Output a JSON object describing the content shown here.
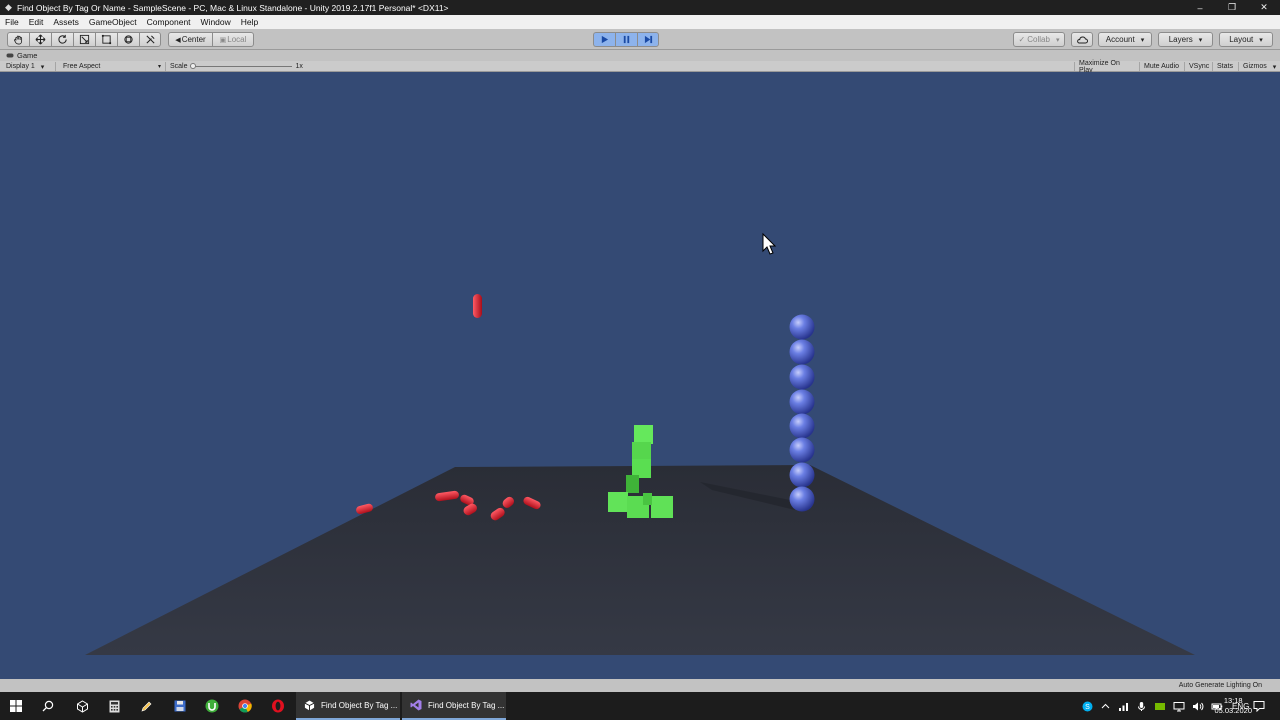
{
  "window": {
    "title": "Find Object By Tag Or Name - SampleScene - PC, Mac & Linux Standalone - Unity 2019.2.17f1 Personal* <DX11>",
    "minimize_glyph": "–",
    "maximize_glyph": "❐",
    "close_glyph": "✕"
  },
  "menu": {
    "items": [
      "File",
      "Edit",
      "Assets",
      "GameObject",
      "Component",
      "Window",
      "Help"
    ]
  },
  "toolbar": {
    "pivot_label": "Center",
    "space_label": "Local",
    "collab_label": "Collab",
    "account_label": "Account",
    "layers_label": "Layers",
    "layout_label": "Layout"
  },
  "game_view": {
    "tab_label": "Game",
    "display_label": "Display 1",
    "aspect_label": "Free Aspect",
    "scale_label": "Scale",
    "scale_value": "1x",
    "maximize_label": "Maximize On Play",
    "mute_label": "Mute Audio",
    "vsync_label": "VSync",
    "stats_label": "Stats",
    "gizmos_label": "Gizmos"
  },
  "status": {
    "text": "Auto Generate Lighting On"
  },
  "taskbar": {
    "tasks": [
      {
        "label": "Find Object By Tag ..."
      },
      {
        "label": "Find Object By Tag ..."
      }
    ],
    "language": "ENG",
    "time": "13:18",
    "date": "05.03.2020"
  },
  "colors": {
    "sky": "#344a74",
    "ground": "#30343f",
    "capsule": "#d11a2a",
    "cube": "#5fe05a",
    "sphere": "#5b6fd8"
  }
}
